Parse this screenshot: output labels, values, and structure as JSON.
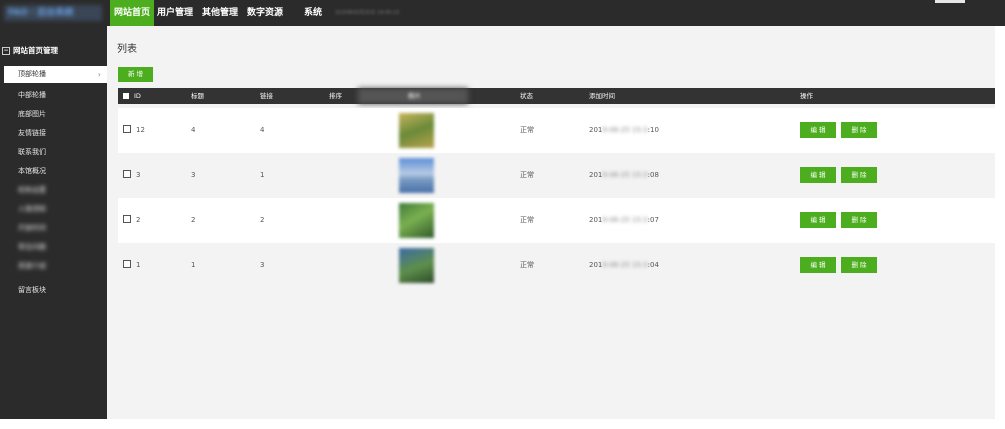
{
  "header": {
    "logo_text": "FAO · 后台系统",
    "nav": [
      "网站首页",
      "用户管理",
      "其他管理",
      "数字资源",
      "系统"
    ],
    "datetime": "2020年05月25日 19:00:15"
  },
  "sidebar": {
    "group_label": "网站首页管理",
    "items": [
      {
        "label": "顶部轮播",
        "active": true
      },
      {
        "label": "中部轮播"
      },
      {
        "label": "底部图片"
      },
      {
        "label": "友情链接"
      },
      {
        "label": "联系我们"
      },
      {
        "label": "本馆概况"
      },
      {
        "label": "机构设置"
      },
      {
        "label": "入馆须知"
      },
      {
        "label": "开放时间"
      },
      {
        "label": "常见问题"
      },
      {
        "label": "资源介绍"
      },
      {
        "label": "留言板块"
      }
    ]
  },
  "main": {
    "title": "列表",
    "add_button": "新 增",
    "columns": {
      "id": "ID",
      "title": "标题",
      "link": "链接",
      "sort": "排序",
      "image": "图片",
      "status": "状态",
      "added": "添加时间",
      "actions": "操作"
    },
    "edit_label": "编 辑",
    "delete_label": "删 除",
    "rows": [
      {
        "id": "12",
        "title": "4",
        "link": "4",
        "status": "正常",
        "time_prefix": "201",
        "time_hidden": "9-06-25 15:3",
        "time_suffix": ":10"
      },
      {
        "id": "3",
        "title": "3",
        "link": "1",
        "status": "正常",
        "time_prefix": "201",
        "time_hidden": "9-06-25 15:3",
        "time_suffix": ":08"
      },
      {
        "id": "2",
        "title": "2",
        "link": "2",
        "status": "正常",
        "time_prefix": "201",
        "time_hidden": "9-06-25 15:3",
        "time_suffix": ":07"
      },
      {
        "id": "1",
        "title": "1",
        "link": "3",
        "status": "正常",
        "time_prefix": "201",
        "time_hidden": "9-06-25 15:3",
        "time_suffix": ":04"
      }
    ]
  },
  "colors": {
    "accent": "#4cae1e",
    "dark": "#2b2b2b"
  }
}
